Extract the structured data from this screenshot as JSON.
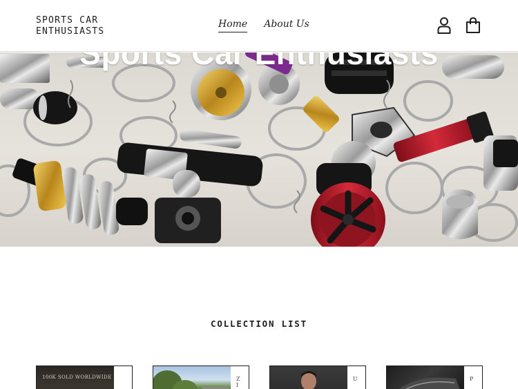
{
  "header": {
    "logo_line1": "SPORTS CAR",
    "logo_line2": "ENTHUSIASTS",
    "nav": [
      {
        "label": "Home",
        "active": true
      },
      {
        "label": "About Us",
        "active": false
      }
    ],
    "account_icon": "user-icon",
    "cart_icon": "shopping-bag-icon"
  },
  "hero": {
    "title": "Sports Car Enthusiasts"
  },
  "collection": {
    "title": "COLLECTION LIST",
    "cards": [
      {
        "image_text": "100K SOLD WORLDWIDE",
        "letter": ""
      },
      {
        "image_text": "",
        "letter": "Z\nI"
      },
      {
        "image_text": "",
        "letter": "U"
      },
      {
        "image_text": "",
        "letter": "P"
      }
    ]
  },
  "colors": {
    "text": "#1c1d1d",
    "background": "#ffffff",
    "accent_red": "#b81e2d",
    "accent_gold": "#d9a520"
  }
}
